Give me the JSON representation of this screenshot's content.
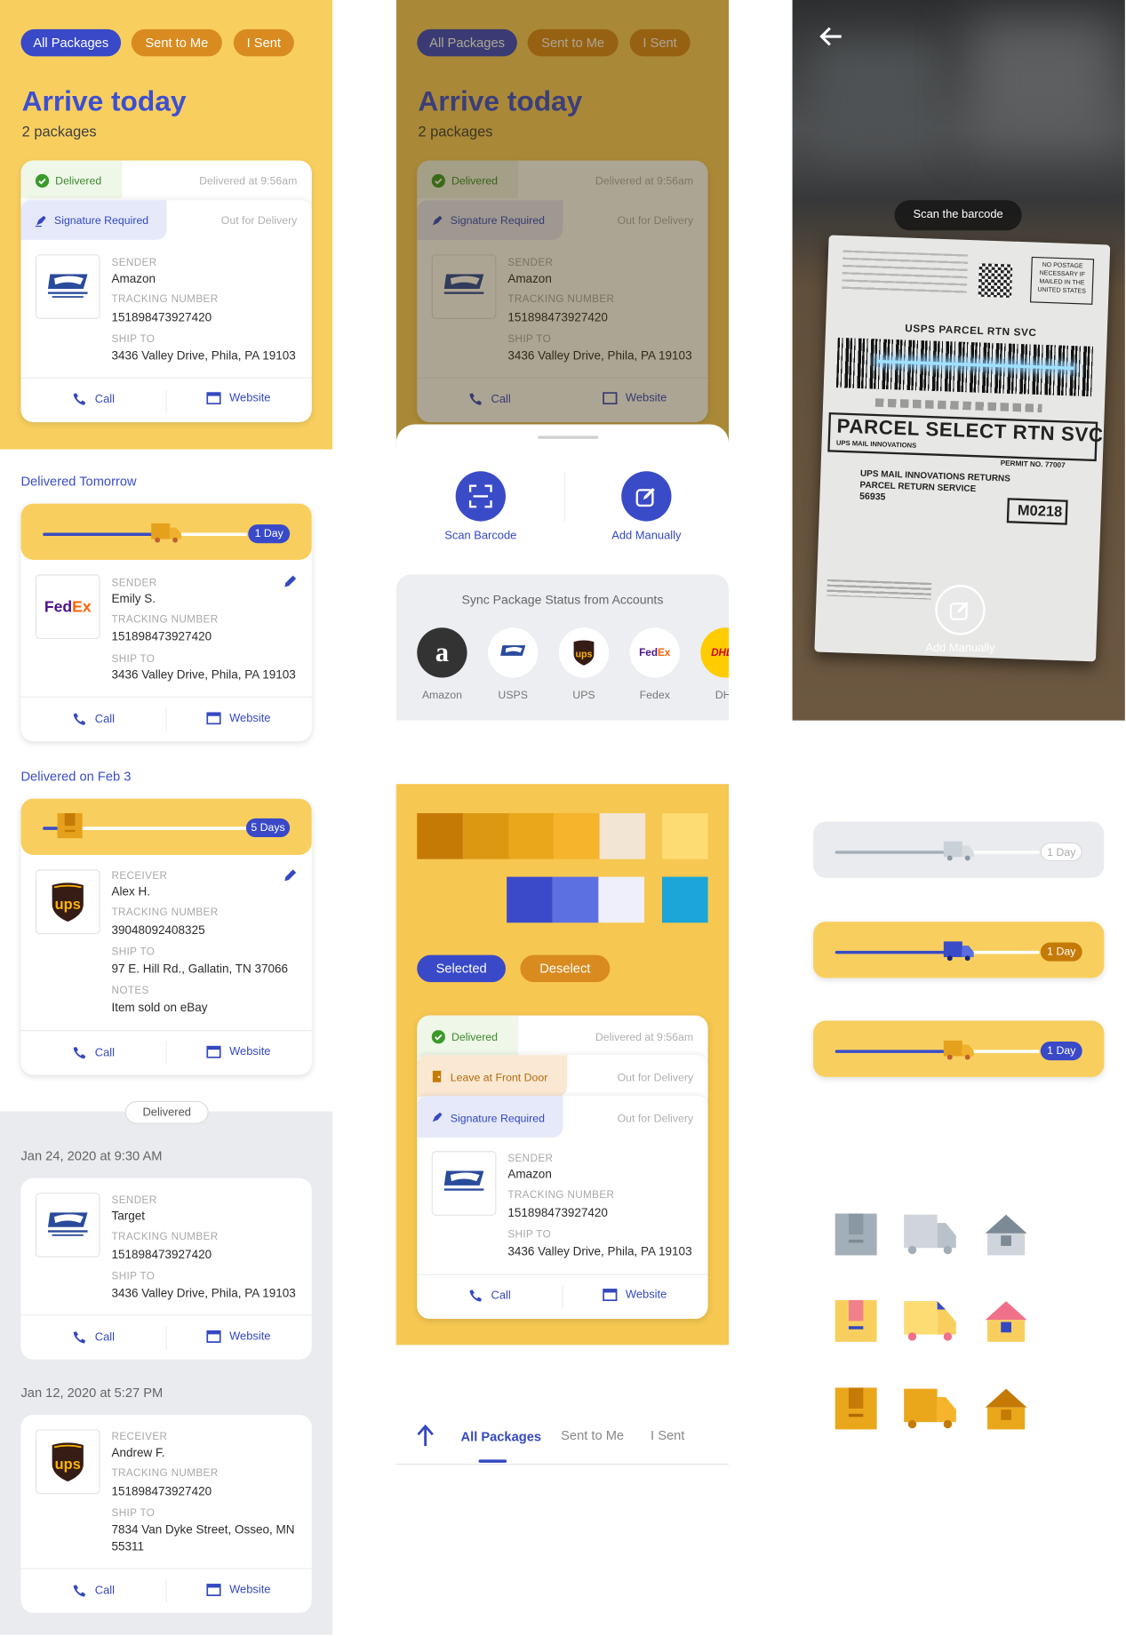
{
  "tabs": {
    "all": "All Packages",
    "sent_to_me": "Sent to Me",
    "i_sent": "I Sent"
  },
  "header": {
    "title": "Arrive today",
    "count": "2 packages"
  },
  "status": {
    "delivered": "Delivered",
    "delivered_at": "Delivered at 9:56am",
    "signature": "Signature Required",
    "out_for_delivery": "Out for Delivery",
    "leave_front": "Leave at Front Door"
  },
  "labels": {
    "sender": "SENDER",
    "receiver": "RECEIVER",
    "tracking": "TRACKING NUMBER",
    "ship_to": "SHIP TO",
    "notes": "NOTES"
  },
  "actions": {
    "call": "Call",
    "website": "Website"
  },
  "sections": {
    "tomorrow": "Delivered Tomorrow",
    "feb3": "Delivered on Feb 3",
    "delivered_divider": "Delivered"
  },
  "card1": {
    "carrier": "USPS",
    "sender": "Amazon",
    "tracking": "151898473927420",
    "ship_to": "3436  Valley Drive, Phila, PA 19103"
  },
  "card2": {
    "carrier": "FedEx",
    "sender": "Emily S.",
    "tracking": "151898473927420",
    "ship_to": "3436  Valley Drive, Phila, PA 19103",
    "days": "1 Day",
    "progress": 0.55
  },
  "card3": {
    "carrier": "UPS",
    "receiver": "Alex H.",
    "tracking": "39048092408325",
    "ship_to": "97 E. Hill Rd., Gallatin, TN 37066",
    "notes": "Item sold on eBay",
    "days": "5 Days",
    "progress": 0.08
  },
  "history": [
    {
      "date": "Jan 24, 2020 at 9:30 AM",
      "carrier": "USPS",
      "sender": "Target",
      "tracking": "151898473927420",
      "ship_to": "3436  Valley Drive, Phila, PA 19103"
    },
    {
      "date": "Jan 12, 2020 at 5:27 PM",
      "carrier": "UPS",
      "receiver": "Andrew F.",
      "tracking": "151898473927420",
      "ship_to_1": "7834 Van Dyke Street, Osseo, MN",
      "ship_to_2": "55311"
    }
  ],
  "sheet": {
    "scan": "Scan Barcode",
    "manual": "Add Manually",
    "sync_title": "Sync Package Status from Accounts",
    "accounts": [
      "Amazon",
      "USPS",
      "UPS",
      "Fedex",
      "DHL"
    ]
  },
  "scanner": {
    "hint": "Scan the barcode",
    "manual": "Add Manually"
  },
  "barcode_label": {
    "top": "USPS PARCEL RTN SVC",
    "big": "PARCEL SELECT RTN SVC",
    "sub": "UPS MAIL INNOVATIONS",
    "permit": "PERMIT NO. 77007",
    "ret1": "UPS MAIL INNOVATIONS RETURNS",
    "ret2": "PARCEL RETURN SERVICE",
    "zip": "56935",
    "code": "M0218",
    "postage": "NO POSTAGE NECESSARY IF MAILED IN THE UNITED STATES"
  },
  "styleguide": {
    "selected": "Selected",
    "deselect": "Deselect",
    "colors_warm": [
      "#c57a06",
      "#dc9812",
      "#eaa71c",
      "#f5b42c",
      "#f3e5d4",
      "#fedc74"
    ],
    "colors_cool": [
      "#3b4ac8",
      "#5d70e2",
      "#eeeffa",
      "#1ba5d8"
    ],
    "progress_days": [
      "1 Day",
      "1 Day",
      "1 Day"
    ]
  },
  "bottom_tabs": {
    "all": "All Packages",
    "sent_to_me": "Sent to Me",
    "i_sent": "I Sent"
  }
}
